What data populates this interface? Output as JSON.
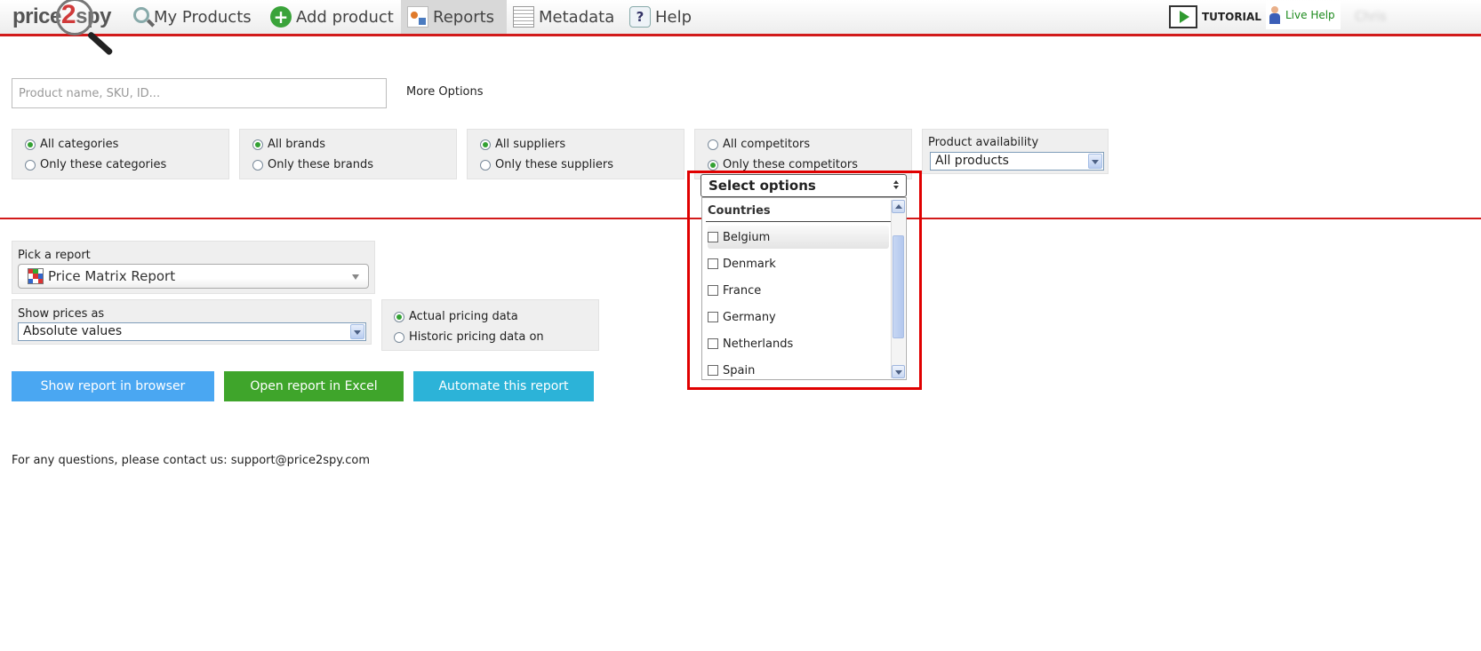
{
  "brand": {
    "logo_text_a": "price",
    "logo_text_b": "2",
    "logo_text_c": "spy"
  },
  "nav": {
    "my_products": "My Products",
    "add_product": "Add product",
    "reports": "Reports",
    "metadata": "Metadata",
    "help": "Help",
    "help_glyph": "?",
    "add_glyph": "+",
    "tutorial": "TUTORIAL",
    "live_help": "Live Help",
    "username": "Chris"
  },
  "search": {
    "placeholder": "Product name, SKU, ID...",
    "more_options": "More Options"
  },
  "filters": {
    "categories": {
      "all": "All categories",
      "only": "Only these categories",
      "selected": "all"
    },
    "brands": {
      "all": "All brands",
      "only": "Only these brands",
      "selected": "all"
    },
    "suppliers": {
      "all": "All suppliers",
      "only": "Only these suppliers",
      "selected": "all"
    },
    "competitors": {
      "all": "All competitors",
      "only": "Only these competitors",
      "selected": "only"
    },
    "availability": {
      "label": "Product availability",
      "value": "All products"
    }
  },
  "multiselect": {
    "button_label": "Select options",
    "group": "Countries",
    "items": [
      {
        "label": "Belgium",
        "checked": false
      },
      {
        "label": "Denmark",
        "checked": false
      },
      {
        "label": "France",
        "checked": false
      },
      {
        "label": "Germany",
        "checked": false
      },
      {
        "label": "Netherlands",
        "checked": false
      },
      {
        "label": "Spain",
        "checked": false
      }
    ]
  },
  "report": {
    "pick_label": "Pick a report",
    "pick_value": "Price Matrix Report",
    "show_prices_label": "Show prices as",
    "show_prices_value": "Absolute values",
    "pricing_actual": "Actual pricing data",
    "pricing_historic": "Historic pricing data on",
    "pricing_selected": "actual"
  },
  "buttons": {
    "show_browser": "Show report in browser",
    "open_excel": "Open report in Excel",
    "automate": "Automate this report"
  },
  "footer": {
    "contact": "For any questions, please contact us: support@price2spy.com"
  },
  "colors": {
    "accent_red": "#d21a1a",
    "btn_blue": "#4aa7f2",
    "btn_green": "#3fa52b",
    "btn_cyan": "#2cb3d8",
    "radio_green": "#33a133"
  }
}
